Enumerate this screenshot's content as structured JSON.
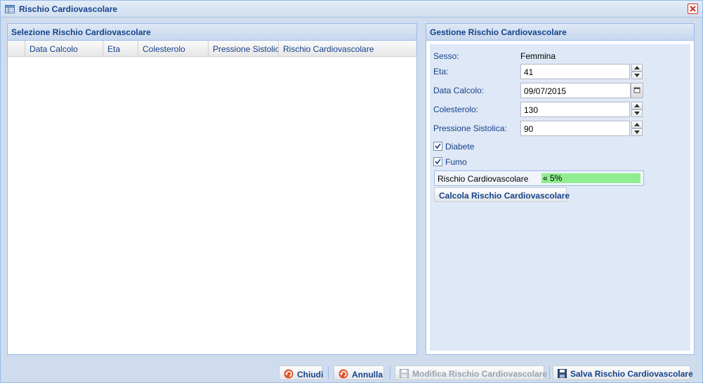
{
  "window": {
    "title": "Rischio Cardiovascolare"
  },
  "left_panel": {
    "title": "Selezione Rischio Cardiovascolare",
    "columns": [
      "Data Calcolo",
      "Eta",
      "Colesterolo",
      "Pressione Sistolica",
      "Rischio Cardiovascolare"
    ]
  },
  "right_panel": {
    "title": "Gestione Rischio Cardiovascolare",
    "sesso_label": "Sesso:",
    "sesso_value": "Femmina",
    "eta_label": "Eta:",
    "eta_value": "41",
    "data_label": "Data Calcolo:",
    "data_value": "09/07/2015",
    "colesterolo_label": "Colesterolo:",
    "colesterolo_value": "130",
    "pressione_label": "Pressione Sistolica:",
    "pressione_value": "90",
    "diabete_label": "Diabete",
    "diabete_checked": true,
    "fumo_label": "Fumo",
    "fumo_checked": true,
    "rischio_label": "Rischio Cardiovascolare",
    "rischio_value": "« 5%",
    "rischio_color": "#90ee90",
    "calcola_button": "Calcola Rischio Cardiovascolare"
  },
  "footer": {
    "chiudi": "Chiudi",
    "annulla": "Annulla",
    "modifica": "Modifica Rischio Cardiovascolare",
    "salva": "Salva Rischio Cardiovascolare"
  },
  "icons": {
    "title": "grid-icon",
    "close": "close-icon",
    "date": "calendar-icon",
    "chiudi": "undo-icon",
    "annulla": "undo-icon",
    "modifica": "save-icon",
    "salva": "save-icon"
  }
}
